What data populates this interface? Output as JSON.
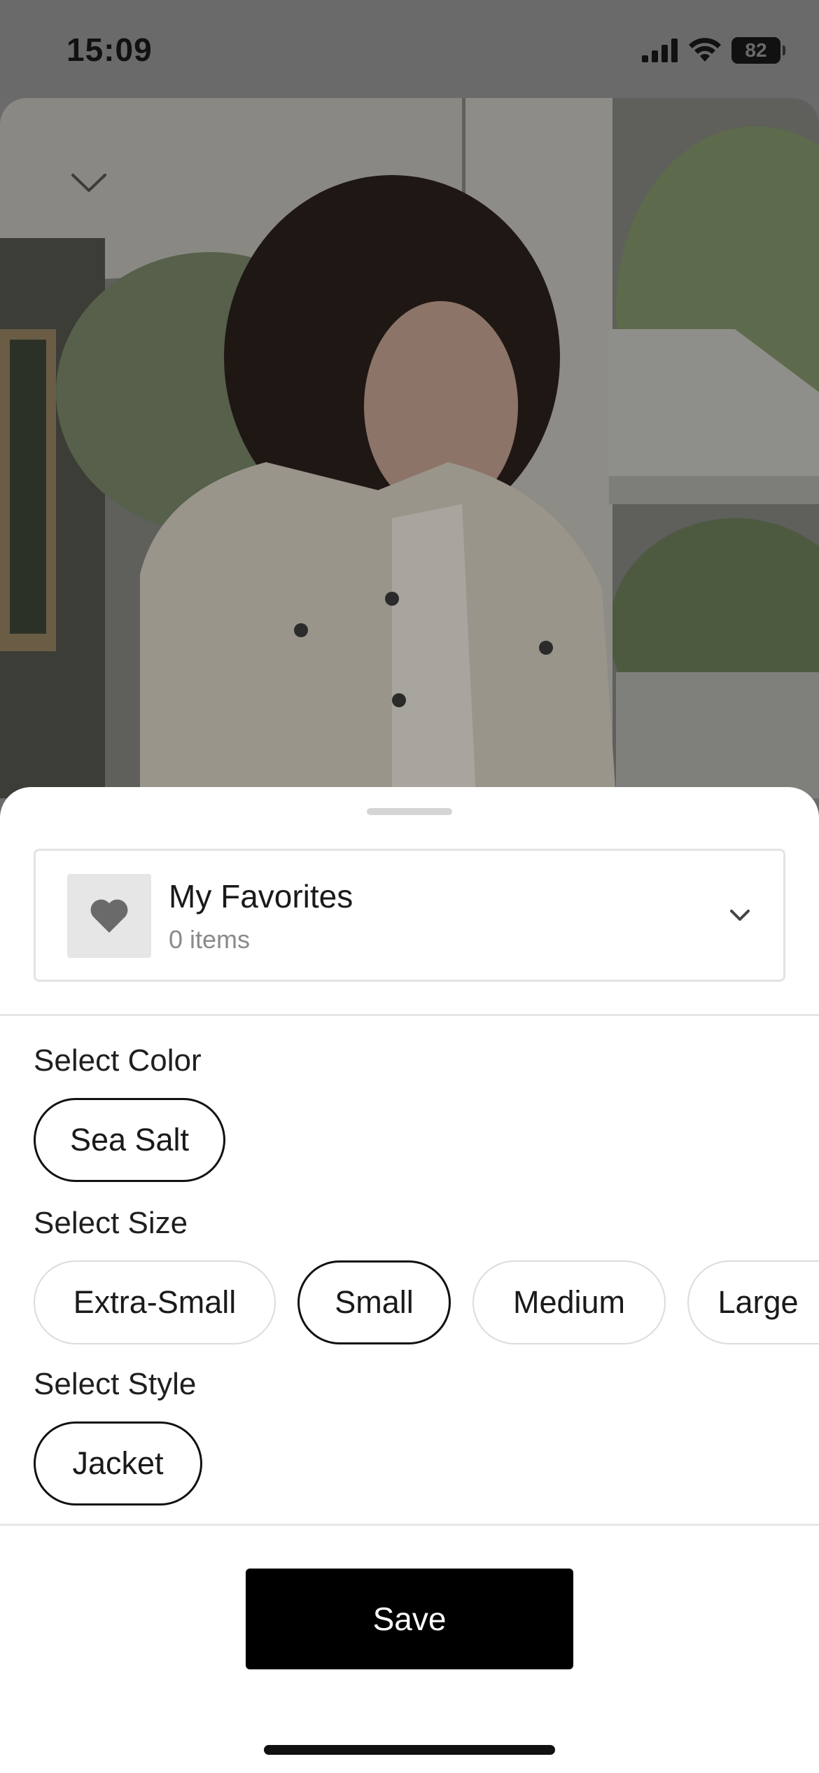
{
  "status_bar": {
    "time": "15:09",
    "battery": "82"
  },
  "collection": {
    "name": "My Favorites",
    "count": "0 items",
    "icon": "heart-icon"
  },
  "color_section": {
    "label": "Select Color",
    "options": [
      {
        "label": "Sea Salt",
        "selected": true
      }
    ]
  },
  "size_section": {
    "label": "Select Size",
    "options": [
      {
        "label": "Extra-Small",
        "selected": false
      },
      {
        "label": "Small",
        "selected": true
      },
      {
        "label": "Medium",
        "selected": false
      },
      {
        "label": "Large",
        "selected": false
      }
    ]
  },
  "style_section": {
    "label": "Select Style",
    "options": [
      {
        "label": "Jacket",
        "selected": true
      }
    ]
  },
  "actions": {
    "save_label": "Save"
  },
  "colors": {
    "accent": "#000000",
    "selected_border": "#111111",
    "chip_border": "#dcdcdc",
    "overlay": "#6b6b6b"
  }
}
